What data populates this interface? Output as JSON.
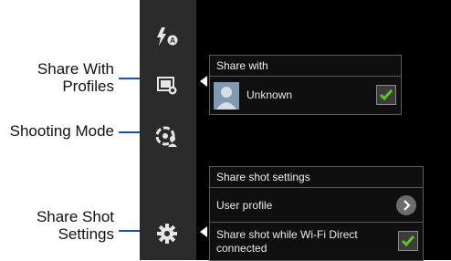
{
  "callouts": {
    "share_with_profiles": [
      "Share With",
      "Profiles"
    ],
    "shooting_mode": "Shooting Mode",
    "share_shot_settings": [
      "Share Shot",
      "Settings"
    ]
  },
  "share_with_panel": {
    "title": "Share with",
    "contact_name": "Unknown",
    "checked": true
  },
  "share_shot_panel": {
    "title": "Share shot settings",
    "user_profile_label": "User profile",
    "wifi_direct_label": [
      "Share shot while Wi-Fi Direct",
      "connected"
    ],
    "wifi_direct_checked": true
  },
  "rail_icons": [
    "flash-auto-icon",
    "share-profiles-icon",
    "shooting-mode-icon",
    "settings-gear-icon"
  ],
  "colors": {
    "accent_check": "#5fc41c",
    "leader_line": "#1f4f9e",
    "rail_bg": "#2b2b2b"
  }
}
